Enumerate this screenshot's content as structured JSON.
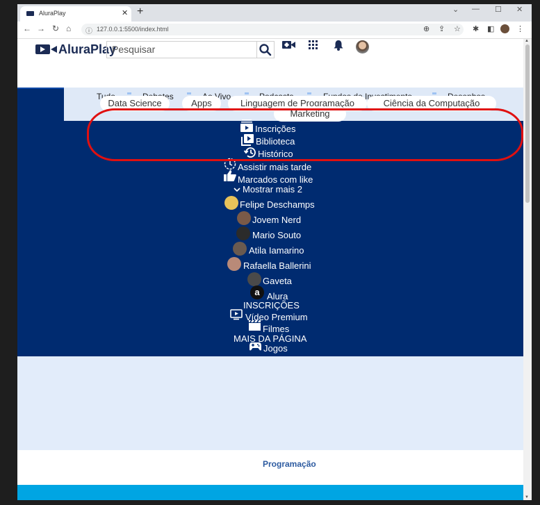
{
  "browser": {
    "tab_title": "AluraPlay",
    "tab_close": "✕",
    "new_tab": "+",
    "address": "127.0.0.1:5500/index.html",
    "controls": {
      "minimize": "⌄",
      "min2": "—",
      "restore": "☐",
      "close": "✕"
    }
  },
  "header": {
    "logo_text": "AluraPlay",
    "search_placeholder": "Pesquisar"
  },
  "categories_behind": [
    "Tudo",
    "Debates",
    "Ao Vivo",
    "Podcasts",
    "Fundos de Investimento",
    "Desenhos"
  ],
  "categories_front": [
    "Data Science",
    "Apps",
    "Linguagem de Programação",
    "Ciência da Computação",
    "Marketing"
  ],
  "nav_items": [
    {
      "label": "Inscrições",
      "icon": "subscriptions-icon"
    },
    {
      "label": "Biblioteca",
      "icon": "library-icon"
    },
    {
      "label": "Histórico",
      "icon": "history-icon"
    },
    {
      "label": "Assistir mais tarde",
      "icon": "watch-later-icon"
    },
    {
      "label": "Marcados com like",
      "icon": "thumbs-up-icon"
    },
    {
      "label": "Mostrar mais 2",
      "icon": "chevron-down-icon"
    }
  ],
  "channels": [
    {
      "name": "Felipe Deschamps",
      "color": "#e8c25a"
    },
    {
      "name": "Jovem Nerd",
      "color": "#7a5a48"
    },
    {
      "name": "Mario Souto",
      "color": "#2b2b2b"
    },
    {
      "name": "Atila Iamarino",
      "color": "#6a5a50"
    },
    {
      "name": "Rafaella Ballerini",
      "color": "#b98a78"
    },
    {
      "name": "Gaveta",
      "color": "#4a4a4a"
    },
    {
      "name": "Alura",
      "color": "#111111"
    }
  ],
  "sections": {
    "inscricoes_heading": "INSCRIÇÕES",
    "mais_heading": "MAIS DA PÁGINA"
  },
  "extra_items": [
    {
      "label": "Vídeo Premium",
      "icon": "premium-video-icon"
    },
    {
      "label": "Filmes",
      "icon": "clapperboard-icon"
    },
    {
      "label": "Jogos",
      "icon": "gamepad-icon"
    }
  ],
  "footer": {
    "link": "Programação"
  },
  "colors": {
    "nav_bg": "#002b70",
    "chip_bg": "#ffffff",
    "annotation": "#e01010",
    "bottom_strip": "#00a5e3"
  }
}
